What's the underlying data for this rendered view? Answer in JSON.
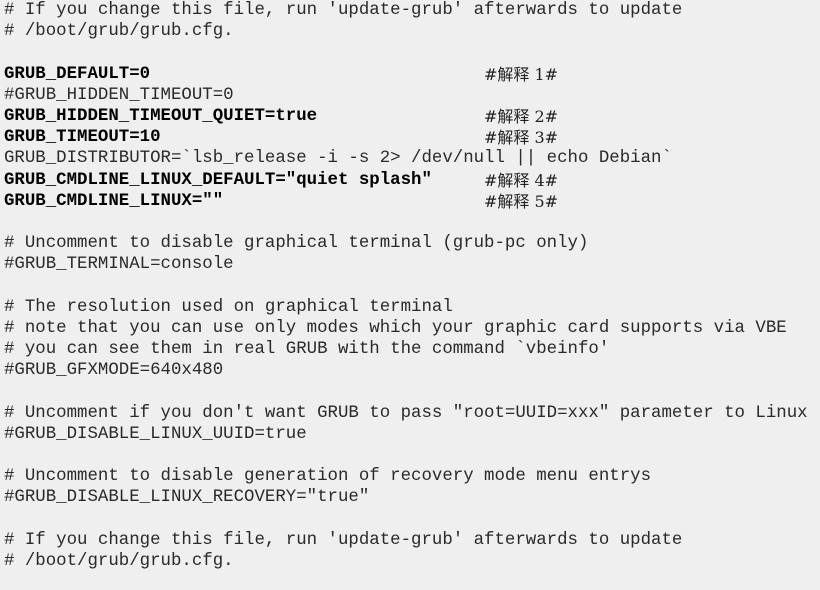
{
  "lines": {
    "l0": "# If you change this file, run 'update-grub' afterwards to update",
    "l1": "# /boot/grub/grub.cfg.",
    "l2": "GRUB_DEFAULT=0",
    "l3": "#GRUB_HIDDEN_TIMEOUT=0",
    "l4": "GRUB_HIDDEN_TIMEOUT_QUIET=true",
    "l5": "GRUB_TIMEOUT=10",
    "l6": "GRUB_DISTRIBUTOR=`lsb_release -i -s 2> /dev/null || echo Debian`",
    "l7": "GRUB_CMDLINE_LINUX_DEFAULT=\"quiet splash\"",
    "l8": "GRUB_CMDLINE_LINUX=\"\"",
    "l9": "# Uncomment to disable graphical terminal (grub-pc only)",
    "l10": "#GRUB_TERMINAL=console",
    "l11": "# The resolution used on graphical terminal",
    "l12": "# note that you can use only modes which your graphic card supports via VBE",
    "l13": "# you can see them in real GRUB with the command `vbeinfo'",
    "l14": "#GRUB_GFXMODE=640x480",
    "l15": "# Uncomment if you don't want GRUB to pass \"root=UUID=xxx\" parameter to Linux",
    "l16": "#GRUB_DISABLE_LINUX_UUID=true",
    "l17": "# Uncomment to disable generation of recovery mode menu entrys",
    "l18": "#GRUB_DISABLE_LINUX_RECOVERY=\"true\"",
    "l19": "# If you change this file, run 'update-grub' afterwards to update",
    "l20": "# /boot/grub/grub.cfg."
  },
  "notes": {
    "n1": "#解释 1#",
    "n2": "#解释 2#",
    "n3": "#解释 3#",
    "n4": "#解释 4#",
    "n5": "#解释 5#"
  }
}
